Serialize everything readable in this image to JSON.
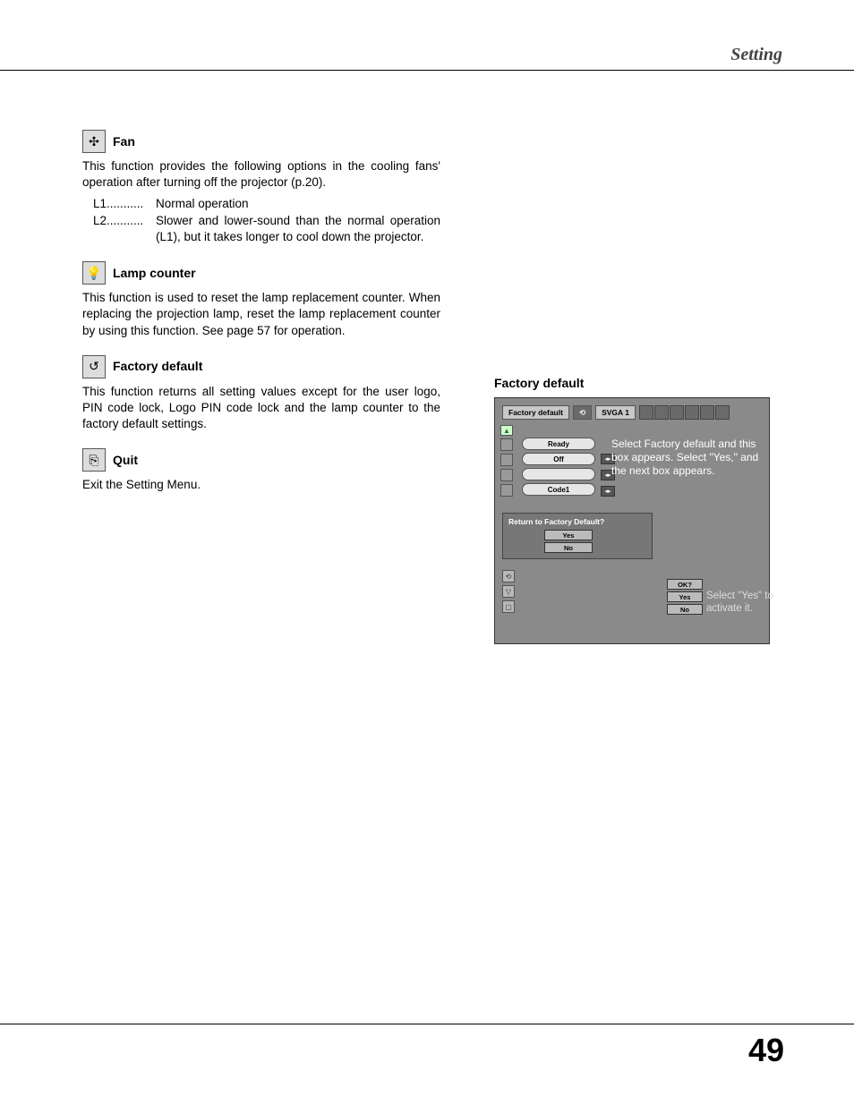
{
  "header": {
    "title": "Setting"
  },
  "page": {
    "number": "49"
  },
  "sections": {
    "fan": {
      "title": "Fan",
      "body": "This function provides the following options in the cooling fans' operation after turning off the projector (p.20).",
      "l1": {
        "key": "L1",
        "val": "Normal operation"
      },
      "l2": {
        "key": "L2",
        "val": "Slower and lower-sound than the normal operation (L1), but it takes longer to cool down the projector."
      }
    },
    "lamp": {
      "title": "Lamp counter",
      "body": "This function is used to reset the lamp replacement counter. When replacing the projection lamp, reset the lamp replacement counter by using this function. See page 57 for operation."
    },
    "factory": {
      "title": "Factory default",
      "body": "This function returns all setting values except for the user logo, PIN code lock, Logo PIN code lock and the lamp counter to the factory default settings."
    },
    "quit": {
      "title": "Quit",
      "body": "Exit the Setting Menu."
    }
  },
  "figure": {
    "title": "Factory default",
    "osd": {
      "top_label": "Factory default",
      "mode": "SVGA 1",
      "pills": [
        "Ready",
        "Off",
        "",
        "Code1"
      ],
      "dialog_title": "Return to Factory Default?",
      "yes": "Yes",
      "no": "No",
      "ok": "OK?"
    },
    "callouts": {
      "c1": "Select Factory default and this box appears.  Select \"Yes,\" and the next box appears.",
      "c2": "Select \"Yes\" to activate it."
    }
  }
}
